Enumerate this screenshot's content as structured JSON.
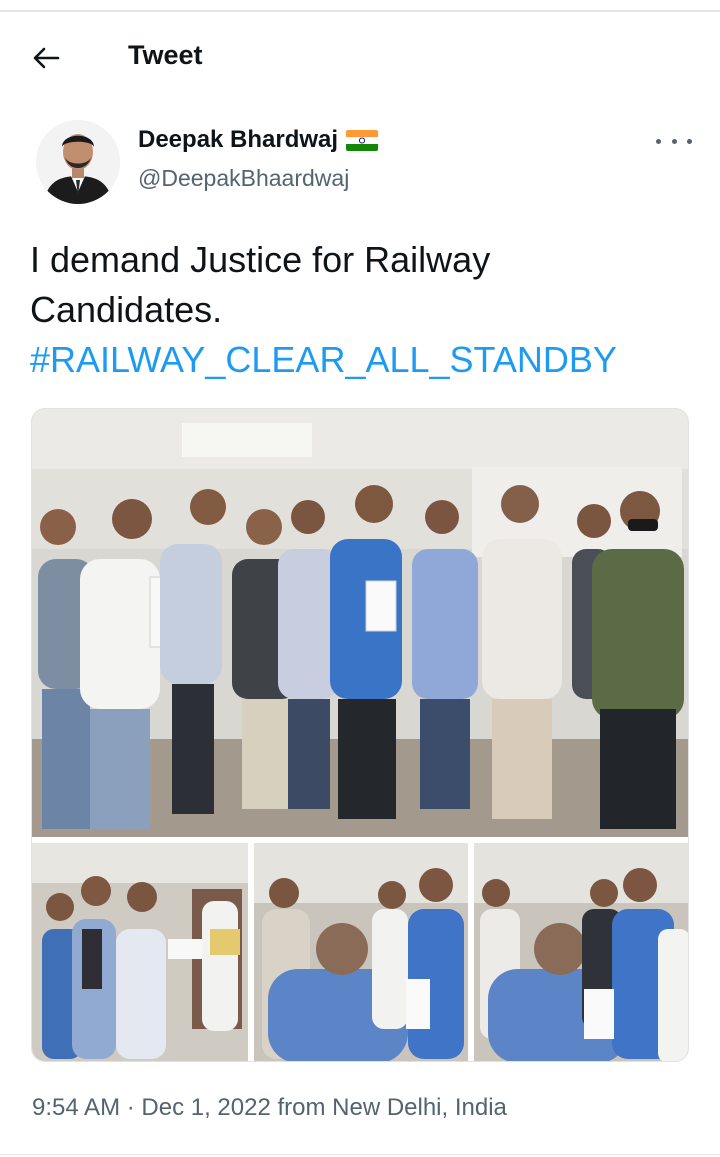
{
  "header": {
    "title": "Tweet"
  },
  "author": {
    "name": "Deepak Bhardwaj",
    "handle": "@DeepakBhaardwaj"
  },
  "tweet": {
    "line1": "I demand Justice for Railway",
    "line2": "Candidates.",
    "hashtag": "#RAILWAY_CLEAR_ALL_STANDBY"
  },
  "meta": {
    "timestamp": "9:54 AM · Dec 1, 2022 from New Delhi, India"
  },
  "icons": {
    "back": "arrow-left-icon",
    "more": "more-horizontal-icon",
    "flag": "india-flag-icon"
  },
  "colors": {
    "hashtag": "#1d9bf0",
    "text": "#0f1419",
    "secondary": "#536471"
  }
}
